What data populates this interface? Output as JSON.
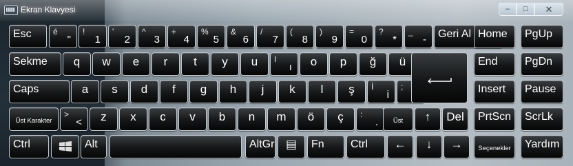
{
  "window": {
    "title": "Ekran Klavyesi",
    "minimize": "–",
    "restore": "□",
    "close": "✕"
  },
  "rows": [
    [
      {
        "id": "esc",
        "label": "Esc"
      },
      {
        "id": "quote",
        "top": "é",
        "bottom": "\""
      },
      {
        "id": "1",
        "top": "!",
        "bottom": "1"
      },
      {
        "id": "2",
        "top": "'",
        "bottom": "2"
      },
      {
        "id": "3",
        "top": "^",
        "bottom": "3"
      },
      {
        "id": "4",
        "top": "+",
        "bottom": "4"
      },
      {
        "id": "5",
        "top": "%",
        "bottom": "5"
      },
      {
        "id": "6",
        "top": "&",
        "bottom": "6"
      },
      {
        "id": "7",
        "top": "/",
        "bottom": "7"
      },
      {
        "id": "8",
        "top": "(",
        "bottom": "8"
      },
      {
        "id": "9",
        "top": ")",
        "bottom": "9"
      },
      {
        "id": "0",
        "top": "=",
        "bottom": "0"
      },
      {
        "id": "asterisk",
        "top": "?",
        "bottom": "*"
      },
      {
        "id": "minus",
        "top": "_",
        "bottom": "-"
      },
      {
        "id": "backspace",
        "label": "Geri Al"
      },
      {
        "id": "home",
        "label": "Home"
      },
      {
        "id": "pgup",
        "label": "PgUp"
      }
    ],
    [
      {
        "id": "tab",
        "label": "Sekme"
      },
      {
        "id": "q",
        "label": "q"
      },
      {
        "id": "w",
        "label": "w"
      },
      {
        "id": "e",
        "label": "e"
      },
      {
        "id": "r",
        "label": "r"
      },
      {
        "id": "t",
        "label": "t"
      },
      {
        "id": "y",
        "label": "y"
      },
      {
        "id": "u",
        "label": "u"
      },
      {
        "id": "dotless-i",
        "top": "I",
        "bottom": "ı"
      },
      {
        "id": "o",
        "label": "o"
      },
      {
        "id": "p",
        "label": "p"
      },
      {
        "id": "gbreve",
        "label": "ğ"
      },
      {
        "id": "udiaeresis",
        "label": "ü"
      },
      {
        "id": "end",
        "label": "End"
      },
      {
        "id": "pgdn",
        "label": "PgDn"
      }
    ],
    [
      {
        "id": "caps",
        "label": "Caps"
      },
      {
        "id": "a",
        "label": "a"
      },
      {
        "id": "s",
        "label": "s"
      },
      {
        "id": "d",
        "label": "d"
      },
      {
        "id": "f",
        "label": "f"
      },
      {
        "id": "g",
        "label": "g"
      },
      {
        "id": "h",
        "label": "h"
      },
      {
        "id": "j",
        "label": "j"
      },
      {
        "id": "k",
        "label": "k"
      },
      {
        "id": "l",
        "label": "l"
      },
      {
        "id": "scedilla",
        "label": "ş"
      },
      {
        "id": "i",
        "top": "İ",
        "bottom": "i"
      },
      {
        "id": "comma",
        "top": ";",
        "bottom": ","
      },
      {
        "id": "insert",
        "label": "Insert"
      },
      {
        "id": "pause",
        "label": "Pause"
      }
    ],
    [
      {
        "id": "lshift",
        "label": "Üst Karakter"
      },
      {
        "id": "angle",
        "top": ">",
        "bottom": "<"
      },
      {
        "id": "z",
        "label": "z"
      },
      {
        "id": "x",
        "label": "x"
      },
      {
        "id": "c",
        "label": "c"
      },
      {
        "id": "v",
        "label": "v"
      },
      {
        "id": "b",
        "label": "b"
      },
      {
        "id": "n",
        "label": "n"
      },
      {
        "id": "m",
        "label": "m"
      },
      {
        "id": "odiaeresis",
        "label": "ö"
      },
      {
        "id": "ccedilla",
        "label": "ç"
      },
      {
        "id": "period",
        "top": ":",
        "bottom": "."
      },
      {
        "id": "rshift",
        "label": "Üst Karakter"
      },
      {
        "id": "up",
        "label": "↑"
      },
      {
        "id": "del",
        "label": "Del"
      },
      {
        "id": "prtscn",
        "label": "PrtScn"
      },
      {
        "id": "scrlk",
        "label": "ScrLk"
      }
    ],
    [
      {
        "id": "lctrl",
        "label": "Ctrl"
      },
      {
        "id": "win",
        "label": ""
      },
      {
        "id": "alt",
        "label": "Alt"
      },
      {
        "id": "space",
        "label": ""
      },
      {
        "id": "altgr",
        "label": "AltGr"
      },
      {
        "id": "menu",
        "label": "▤"
      },
      {
        "id": "fn",
        "label": "Fn"
      },
      {
        "id": "rctrl",
        "label": "Ctrl"
      },
      {
        "id": "left",
        "label": "←"
      },
      {
        "id": "down",
        "label": "↓"
      },
      {
        "id": "right",
        "label": "→"
      },
      {
        "id": "options",
        "label": "Seçenekler"
      },
      {
        "id": "help",
        "label": "Yardım"
      }
    ]
  ]
}
